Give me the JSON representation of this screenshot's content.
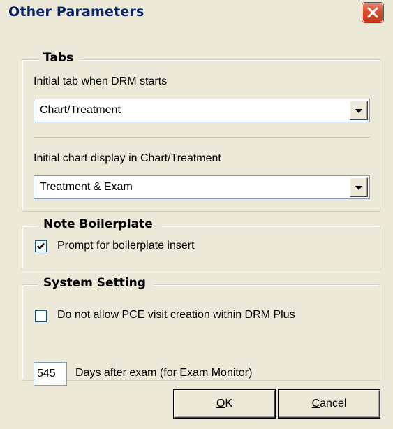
{
  "window": {
    "title": "Other Parameters",
    "close_icon": "close-icon"
  },
  "tabs_group": {
    "title": "Tabs",
    "initial_tab_label": "Initial tab when DRM starts",
    "initial_tab_value": "Chart/Treatment",
    "initial_chart_label": "Initial chart display in Chart/Treatment",
    "initial_chart_value": "Treatment & Exam"
  },
  "note_group": {
    "title": "Note Boilerplate",
    "prompt_label": "Prompt for boilerplate insert",
    "prompt_checked": true
  },
  "system_group": {
    "title": "System Setting",
    "pce_label": "Do not allow PCE visit creation within DRM Plus",
    "pce_checked": false,
    "days_value": "545",
    "days_label": "Days after exam (for Exam Monitor)"
  },
  "buttons": {
    "ok_mnemonic": "O",
    "ok_rest": "K",
    "cancel_mnemonic": "C",
    "cancel_rest": "ancel"
  }
}
